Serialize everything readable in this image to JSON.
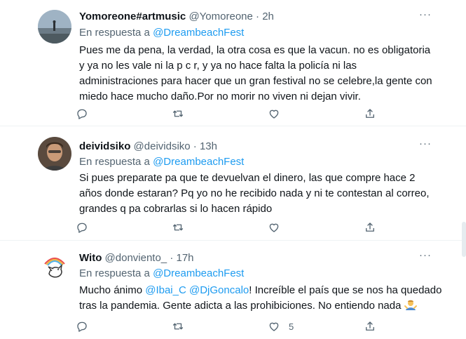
{
  "colors": {
    "link": "#1d9bf0",
    "secondary": "#536471",
    "divider": "#eff3f4"
  },
  "tweets": [
    {
      "name": "Yomoreone#artmusic",
      "handle": "@Yomoreone",
      "dot": "·",
      "time": "2h",
      "reply_prefix": "En respuesta a",
      "reply_mention": "@DreambeachFest",
      "lines": [
        "Pues me da pena, la verdad, la otra cosa es que la vacun. no es obligatoria",
        "y ya no les vale ni la p c r, y ya no hace falta la policía ni las",
        "administraciones para hacer que un gran festival no se celebre,la gente con",
        "miedo hace mucho daño.Por no morir no viven ni dejan vivir."
      ]
    },
    {
      "name": "deividsiko",
      "handle": "@deividsiko",
      "dot": "·",
      "time": "13h",
      "reply_prefix": "En respuesta a",
      "reply_mention": "@DreambeachFest",
      "lines": [
        "Si pues preparate pa que te devuelvan el dinero, las que compre hace 2",
        "años donde estaran? Pq yo no he recibido nada y ni te contestan al correo,",
        "grandes q pa cobrarlas si lo hacen rápido"
      ]
    },
    {
      "name": "Wito",
      "handle": "@donviento_",
      "dot": "·",
      "time": "17h",
      "reply_prefix": "En respuesta a",
      "reply_mention": "@DreambeachFest",
      "line1_prefix": "Mucho ánimo ",
      "line1_mention1": "@Ibai_C",
      "line1_mention2": "@DjGoncalo",
      "line1_suffix": "! Increíble el país que se nos ha quedado",
      "line2": "tras la pandemia. Gente adicta a las prohibiciones. No entiendo nada",
      "like_count": "5"
    }
  ],
  "icons": {
    "more": "more-horizontal-icon",
    "reply": "reply-bubble-icon",
    "retweet": "retweet-icon",
    "like": "heart-icon",
    "share": "share-icon",
    "emoji": "man-shrugging-emoji-icon"
  },
  "more_glyph": "···"
}
